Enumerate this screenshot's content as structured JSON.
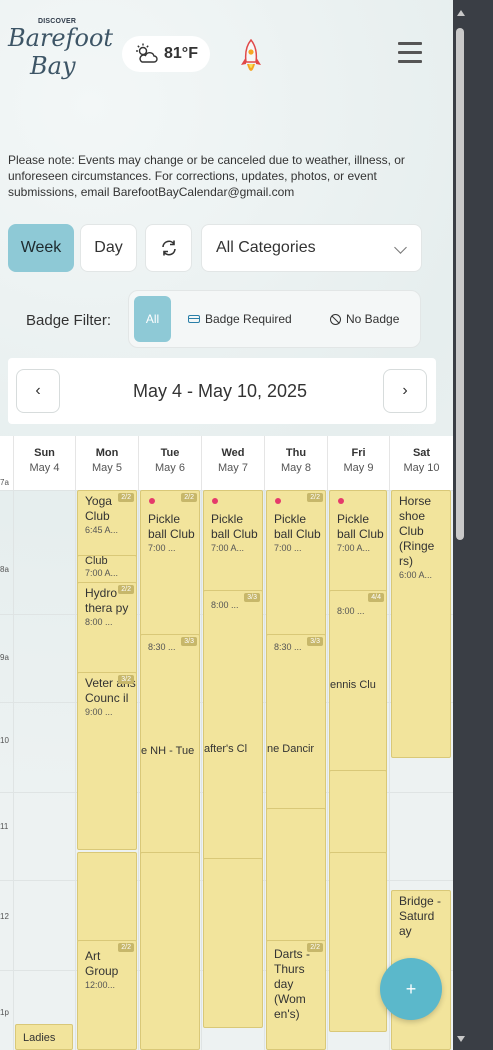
{
  "header": {
    "logo_small": "DISCOVER",
    "logo_line1": "Barefoot",
    "logo_line2": "Bay",
    "temperature": "81°F",
    "weather_icon": "partly-sunny-icon",
    "rocket_icon": "rocket-icon",
    "menu_icon": "hamburger-menu-icon"
  },
  "notice": "Please note: Events may change or be canceled due to weather, illness, or unforeseen circumstances. For corrections, updates, photos, or event submissions, email BarefootBayCalendar@gmail.com",
  "controls": {
    "week_label": "Week",
    "day_label": "Day",
    "category_value": "All Categories"
  },
  "badge_filter": {
    "label": "Badge Filter:",
    "all": "All",
    "required": "Badge Required",
    "none": "No Badge"
  },
  "date_nav": {
    "prev": "‹",
    "range": "May 4 - May 10, 2025",
    "next": "›"
  },
  "days": [
    {
      "name": "Sun",
      "date": "May 4"
    },
    {
      "name": "Mon",
      "date": "May 5"
    },
    {
      "name": "Tue",
      "date": "May 6"
    },
    {
      "name": "Wed",
      "date": "May 7"
    },
    {
      "name": "Thu",
      "date": "May 8"
    },
    {
      "name": "Fri",
      "date": "May 9"
    },
    {
      "name": "Sat",
      "date": "May 10"
    }
  ],
  "time_labels": [
    "7a",
    "8a",
    "9a",
    "10",
    "11",
    "12",
    "1p"
  ],
  "events": {
    "mon_yoga": {
      "title": "Yoga Club",
      "time": "6:45 A...",
      "badge": "2/2"
    },
    "mon_club": {
      "title": "Club",
      "time": "7:00 A..."
    },
    "mon_hydro": {
      "title": "Hydro thera py",
      "time": "8:00 ...",
      "badge": "2/2"
    },
    "mon_veterans": {
      "title": "Veter ans Counc il",
      "time": "9:00 ...",
      "badge": "3/2"
    },
    "mon_art": {
      "title": "Art Group",
      "time": "12:00...",
      "badge": "2/2"
    },
    "tue_pickle": {
      "title": "Pickle ball Club",
      "time": "7:00 ...",
      "badge": "2/2"
    },
    "tue_830": {
      "time": "8:30 ...",
      "badge": "3/3"
    },
    "tue_nh": {
      "title": "e NH - Tue"
    },
    "wed_pickle": {
      "title": "Pickle ball Club",
      "time": "7:00 A..."
    },
    "wed_800": {
      "time": "8:00 ...",
      "badge": "3/3"
    },
    "wed_crafters": {
      "title": "after's Cl"
    },
    "thu_pickle": {
      "title": "Pickle ball Club",
      "time": "7:00 ...",
      "badge": "2/2"
    },
    "thu_830": {
      "time": "8:30 ...",
      "badge": "3/3"
    },
    "thu_dancing": {
      "title": "ne Dancir"
    },
    "thu_darts": {
      "title": "Darts - Thurs day (Wom en's)",
      "badge": "2/2"
    },
    "fri_pickle": {
      "title": "Pickle ball Club",
      "time": "7:00 A..."
    },
    "fri_800": {
      "time": "8:00 ...",
      "badge": "4/4"
    },
    "fri_tennis": {
      "title": "ennis Clu"
    },
    "sat_horseshoe": {
      "title": "Horse shoe Club (Ringe rs)",
      "time": "6:00 A..."
    },
    "sat_bridge": {
      "title": "Bridge - Saturd ay"
    },
    "sun_ladies": {
      "title": "Ladies"
    }
  },
  "fab_label": "+",
  "colors": {
    "accent": "#8ec9d6",
    "fab": "#5bb8cb",
    "event_bg": "#f2e49c",
    "heart": "#e53a6b"
  }
}
